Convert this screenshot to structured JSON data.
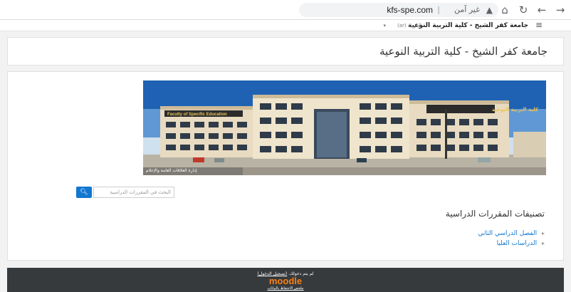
{
  "browser": {
    "url_host": "kfs-spe.com",
    "security_label": "غير آمن",
    "separator": "|"
  },
  "navbar": {
    "brand": "جامعة كفر الشيخ - كلية التربية النوعية",
    "language": "العربية (ar)"
  },
  "header": {
    "title": "جامعة كفر الشيخ - كلية التربية النوعية"
  },
  "banner": {
    "building_sign_left": "Faculty of Specific Education",
    "building_sign_right": "كلية التربية النوعية",
    "caption": "إدارة العلاقات العامة والإعلام"
  },
  "search": {
    "placeholder": "البحث في المقررات الدراسية",
    "button_icon": "search-icon"
  },
  "categories": {
    "title": "تصنيفات المقررات الدراسية",
    "items": [
      {
        "label": "الفصل الدراسي الثاني"
      },
      {
        "label": "الدراسات العليا"
      }
    ]
  },
  "footer": {
    "login_text": "لم يتم دخولك.",
    "login_link": "(تسجيل الدخول)",
    "logo": "moodle",
    "retention": "ملخص الاحتفاظ بالبيانات"
  },
  "colors": {
    "accent": "#1177d1",
    "footer_bg": "#373a3c",
    "moodle_orange": "#f98012"
  }
}
